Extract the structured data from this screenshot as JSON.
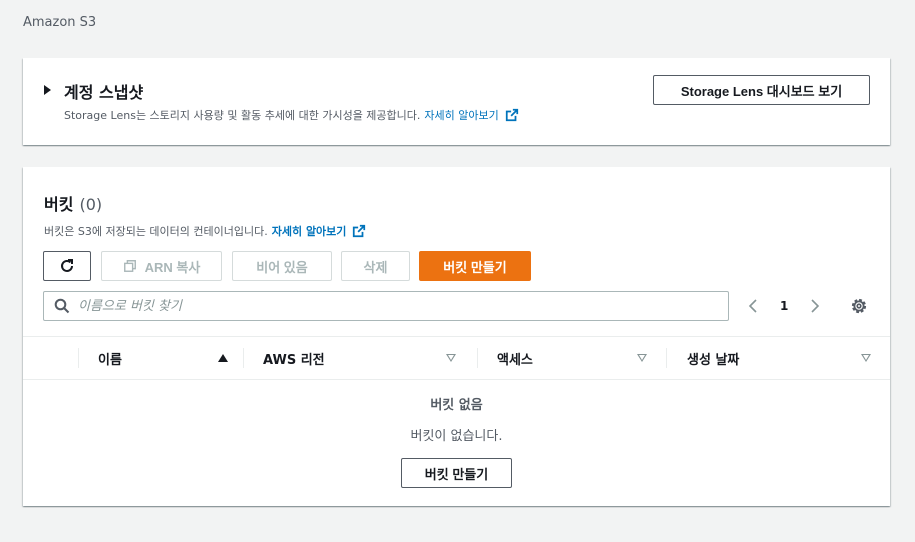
{
  "page": {
    "title": "Amazon S3"
  },
  "snapshot": {
    "title": "계정 스냅샷",
    "description": "Storage Lens는 스토리지 사용량 및 활동 추세에 대한 가시성을 제공합니다.",
    "learn_more": "자세히 알아보기",
    "lens_button": "Storage Lens 대시보드 보기"
  },
  "buckets": {
    "title": "버킷",
    "count": "(0)",
    "description": "버킷은 S3에 저장되는 데이터의 컨테이너입니다.",
    "learn_more": "자세히 알아보기",
    "actions": {
      "copy_arn": "ARN 복사",
      "empty": "비어 있음",
      "delete": "삭제",
      "create": "버킷 만들기"
    },
    "search": {
      "placeholder": "이름으로 버킷 찾기"
    },
    "pagination": {
      "page": "1"
    },
    "columns": [
      "이름",
      "AWS 리전",
      "액세스",
      "생성 날짜"
    ],
    "empty_state": {
      "title": "버킷 없음",
      "description": "버킷이 없습니다.",
      "create_button": "버킷 만들기"
    }
  },
  "colors": {
    "primary": "#ec7211",
    "link": "#0073bb",
    "background": "#f2f3f3"
  },
  "icons": [
    "caret-right-icon",
    "external-link-icon",
    "refresh-icon",
    "copy-icon",
    "search-icon",
    "chevron-left-icon",
    "chevron-right-icon",
    "gear-icon",
    "sort-ascending-icon",
    "sort-descending-icon"
  ]
}
